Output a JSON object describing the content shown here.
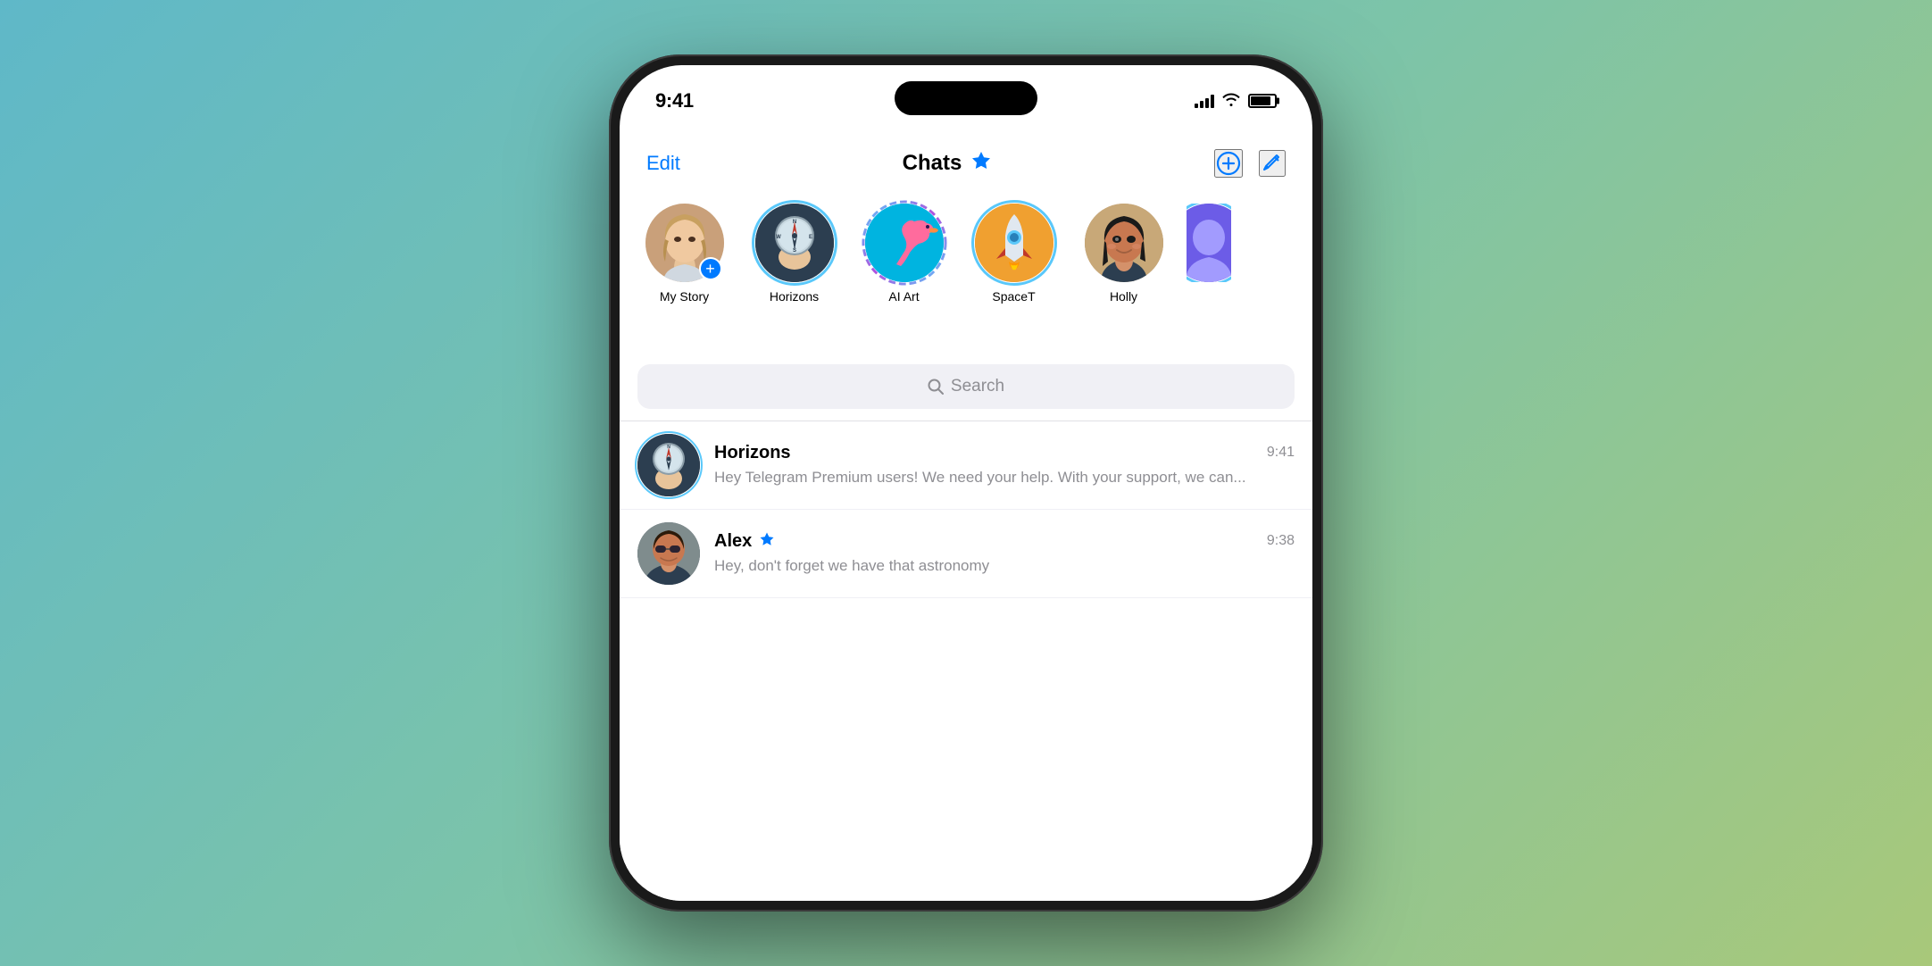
{
  "background": {
    "gradient_start": "#5fb8c8",
    "gradient_end": "#a8c87a"
  },
  "phone": {
    "status_bar": {
      "time": "9:41",
      "signal_label": "signal-bars",
      "wifi_label": "wifi-icon",
      "battery_label": "battery-icon"
    },
    "nav": {
      "edit_label": "Edit",
      "title": "Chats",
      "star_icon": "⭐",
      "add_icon": "⊕",
      "compose_icon": "✎"
    },
    "stories": [
      {
        "id": "my-story",
        "label": "My Story",
        "has_plus": true,
        "ring": "none"
      },
      {
        "id": "horizons",
        "label": "Horizons",
        "has_plus": false,
        "ring": "active"
      },
      {
        "id": "ai-art",
        "label": "AI Art",
        "has_plus": false,
        "ring": "dashed"
      },
      {
        "id": "spacet",
        "label": "SpaceT",
        "has_plus": false,
        "ring": "active"
      },
      {
        "id": "holly",
        "label": "Holly",
        "has_plus": false,
        "ring": "none"
      },
      {
        "id": "partial",
        "label": "",
        "has_plus": false,
        "ring": "active"
      }
    ],
    "search": {
      "placeholder": "Search"
    },
    "chats": [
      {
        "id": "horizons-chat",
        "name": "Horizons",
        "has_star": false,
        "time": "9:41",
        "preview": "Hey Telegram Premium users!  We need your help. With your support, we can..."
      },
      {
        "id": "alex-chat",
        "name": "Alex",
        "has_star": true,
        "time": "9:38",
        "preview": "Hey, don't forget we have that astronomy"
      }
    ]
  }
}
